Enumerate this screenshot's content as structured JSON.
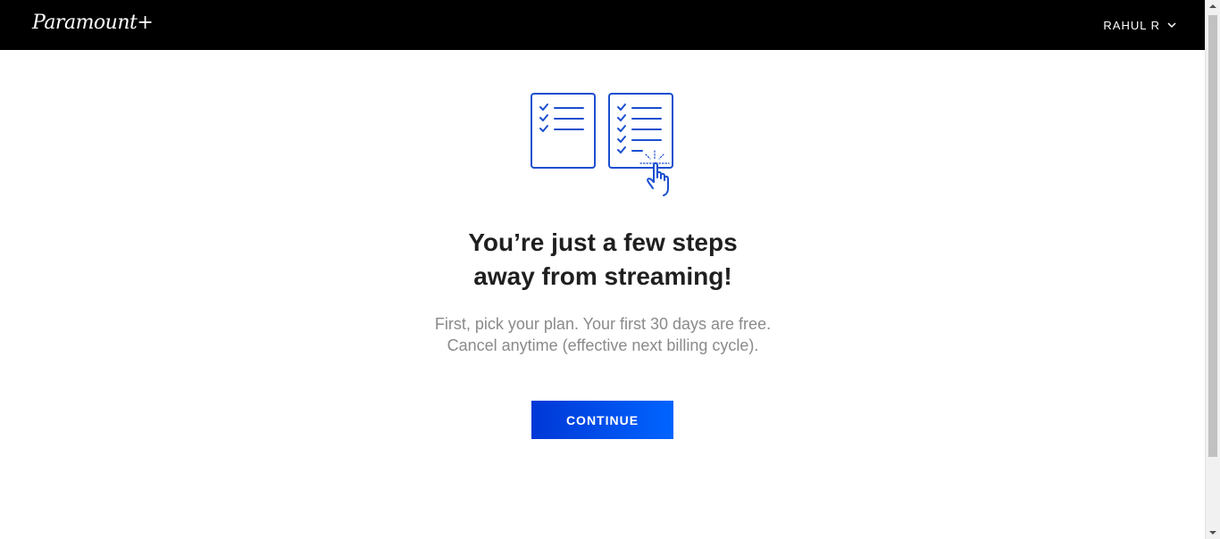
{
  "header": {
    "logo_text": "Paramount+",
    "user_name": "RAHUL R"
  },
  "main": {
    "headline_line1": "You’re just a few steps",
    "headline_line2": "away from streaming!",
    "subtext": "First, pick your plan. Your first 30 days are free. Cancel anytime (effective next billing cycle).",
    "continue_label": "CONTINUE"
  },
  "icons": {
    "illustration": "checklist-with-pointing-hand",
    "user_menu": "chevron-down-icon"
  },
  "colors": {
    "header_bg": "#000000",
    "accent_blue": "#0064ff",
    "illustration_blue": "#1b4fcf",
    "headline": "#1f1f1f",
    "subtext": "#8a8a8a"
  }
}
